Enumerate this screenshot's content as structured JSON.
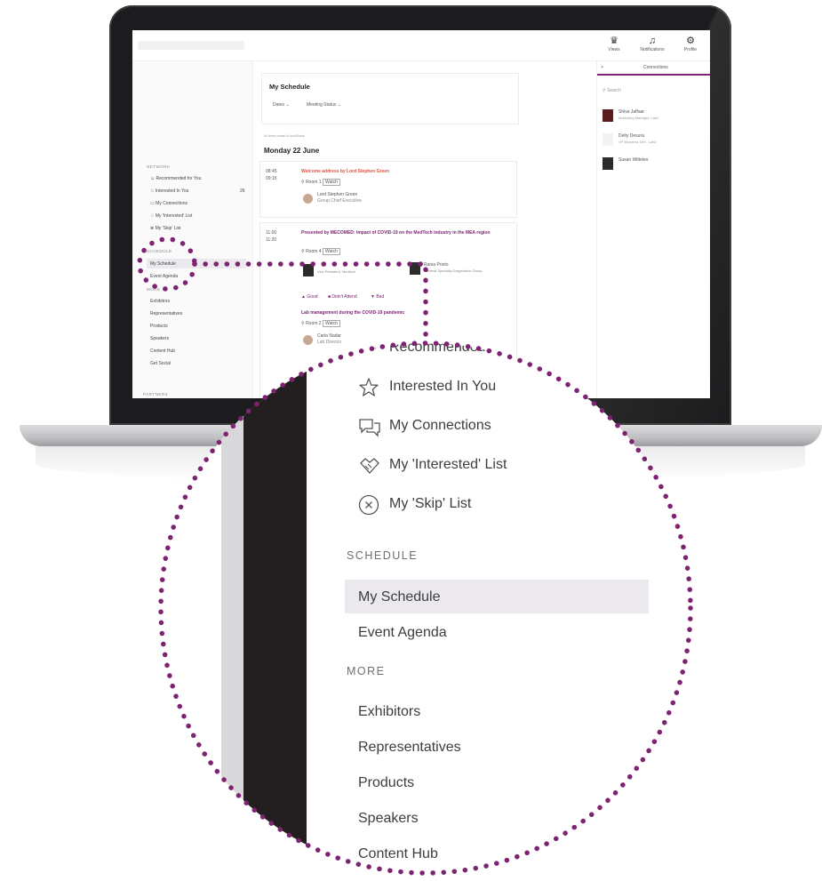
{
  "app": {
    "top_icons": [
      {
        "label": "Views",
        "icon": "trophy-icon"
      },
      {
        "label": "Notifications",
        "icon": "bell-icon"
      },
      {
        "label": "Profile",
        "icon": "profile-icon"
      }
    ]
  },
  "mini_sidebar": {
    "networking_header": "NETWORK",
    "networking_items": [
      "Recommended for You",
      "Interested In You",
      "My Connections",
      "My 'Interested' List",
      "My 'Skip' List"
    ],
    "interested_count": "26",
    "schedule_header": "SCHEDULE",
    "schedule_items": [
      "My Schedule",
      "Event Agenda"
    ],
    "more_header": "MORE",
    "more_items": [
      "Exhibitors",
      "Representatives",
      "Products",
      "Speakers",
      "Content Hub",
      "Get Social"
    ],
    "footer_header": "PARTNERS"
  },
  "schedule": {
    "title": "My Schedule",
    "filter_1": "Dates",
    "filter_2": "Meeting Status",
    "timezone_note": "All times shown in Asia/Dubai",
    "day_heading": "Monday 22 June",
    "sessions": [
      {
        "time_start": "08:45",
        "time_end": "09:15",
        "title": "Welcome address by Lord Stephen Green",
        "room": "Room 1",
        "badge": "Watch",
        "speaker_name": "Lord Stephen Green",
        "speaker_role": "Group Chief Executive"
      },
      {
        "time_start": "11:00",
        "time_end": "11:20",
        "title": "Presented by MECOMED: Impact of COVID-19 on the MedTech industry in the MEA region",
        "room": "Room 4",
        "badge": "Watch",
        "speaker_1_role": "Vice President, Medtech",
        "speaker_2_name": "Rania Prieto",
        "speaker_2_role": "General Specialty Diagnostics Group",
        "actions": [
          "Good",
          "Didn't Attend",
          "Bad"
        ],
        "sub_title": "Lab management during the COVID-19 pandemic",
        "sub_room": "Room 2",
        "sub_badge": "Watch",
        "sub_speaker_name": "Carla Nadar",
        "sub_speaker_role": "Lab Director"
      }
    ]
  },
  "connections": {
    "title": "Connections",
    "search_placeholder": "Search",
    "people": [
      {
        "name": "Shiva Jaffaar",
        "role": "Marketing Manager, Lab2"
      },
      {
        "name": "Delty Desura",
        "role": "VP Business Dev., Lab2"
      },
      {
        "name": "Susan Witteles",
        "role": ""
      }
    ]
  },
  "magnified": {
    "partial_item": "Recommended f",
    "network_items": [
      {
        "label": "Interested In You",
        "icon": "star-icon"
      },
      {
        "label": "My Connections",
        "icon": "chat-bubbles-icon"
      },
      {
        "label": "My 'Interested' List",
        "icon": "handshake-icon"
      },
      {
        "label": "My 'Skip' List",
        "icon": "close-circle-icon"
      }
    ],
    "schedule_header": "SCHEDULE",
    "schedule_items": [
      "My Schedule",
      "Event Agenda"
    ],
    "more_header": "MORE",
    "more_items": [
      "Exhibitors",
      "Representatives",
      "Products",
      "Speakers",
      "Content Hub"
    ]
  },
  "colors": {
    "accent": "#7d2372",
    "highlight_bg": "#ece9ee",
    "laptop_body": "#1c1c1e",
    "alert": "#e0553f"
  }
}
